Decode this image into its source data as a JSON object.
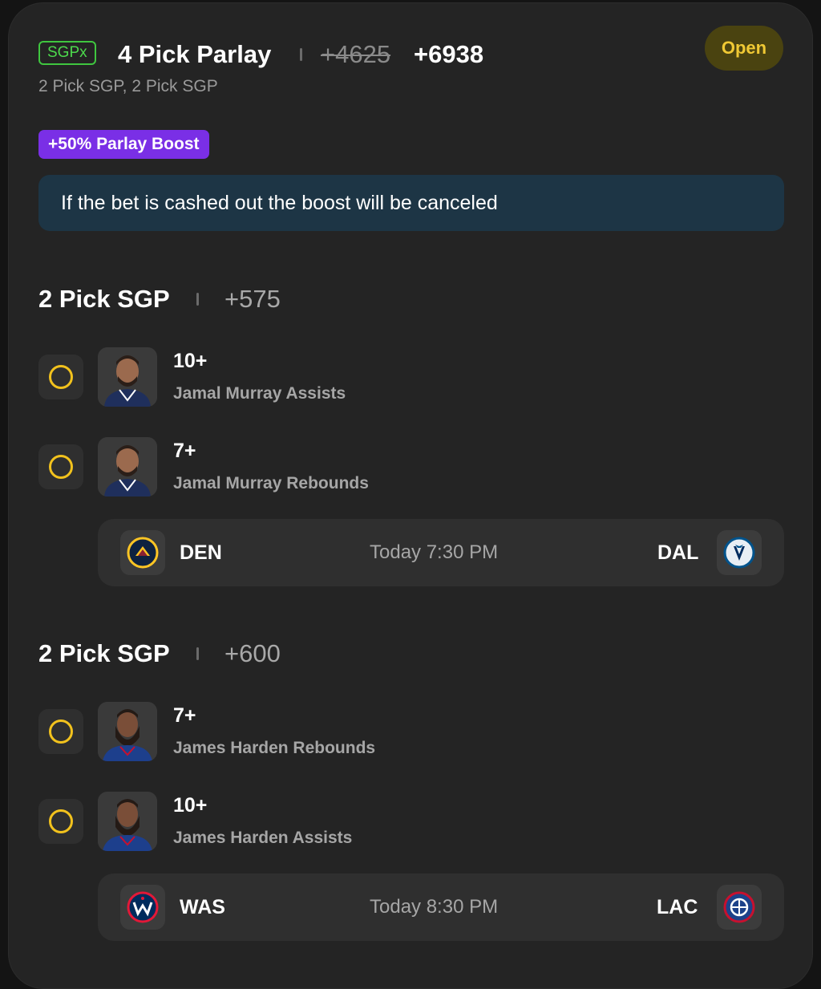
{
  "header": {
    "badge": "SGPx",
    "title": "4 Pick Parlay",
    "odds_original": "+4625",
    "odds_boosted": "+6938",
    "status": "Open",
    "subtitle": "2 Pick SGP, 2 Pick SGP"
  },
  "boost": {
    "badge": "+50% Parlay Boost",
    "notice": "If the bet is cashed out the boost will be canceled"
  },
  "sections": [
    {
      "title": "2 Pick SGP",
      "odds": "+575",
      "picks": [
        {
          "value": "10+",
          "label": "Jamal Murray Assists"
        },
        {
          "value": "7+",
          "label": "Jamal Murray Rebounds"
        }
      ],
      "game": {
        "home": "DEN",
        "time": "Today 7:30 PM",
        "away": "DAL"
      }
    },
    {
      "title": "2 Pick SGP",
      "odds": "+600",
      "picks": [
        {
          "value": "7+",
          "label": "James Harden Rebounds"
        },
        {
          "value": "10+",
          "label": "James Harden Assists"
        }
      ],
      "game": {
        "home": "WAS",
        "time": "Today 8:30 PM",
        "away": "LAC"
      }
    }
  ],
  "colors": {
    "accent_yellow": "#f2c21d",
    "sgpx_green": "#4cd94c",
    "boost_purple": "#7a2fe6",
    "notice_bg": "#1d3545"
  }
}
